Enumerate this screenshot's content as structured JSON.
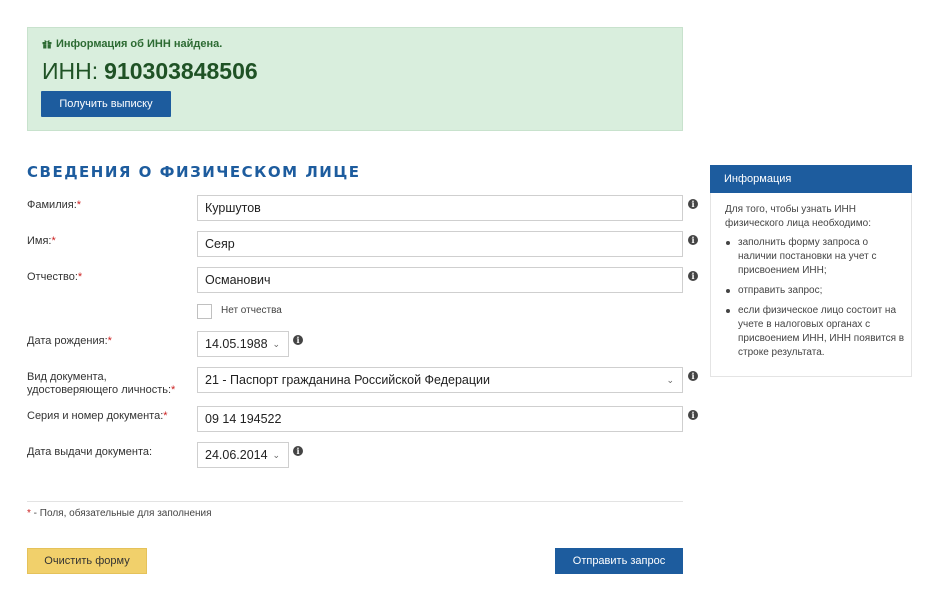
{
  "result": {
    "message": "Информация об ИНН найдена.",
    "inn_label": "ИНН:",
    "inn_value": "910303848506",
    "extract_button": "Получить выписку"
  },
  "section_title": "СВЕДЕНИЯ О ФИЗИЧЕСКОМ ЛИЦЕ",
  "form": {
    "surname": {
      "label": "Фамилия:",
      "value": "Куршутов"
    },
    "name": {
      "label": "Имя:",
      "value": "Сеяр"
    },
    "patronymic": {
      "label": "Отчество:",
      "value": "Османович"
    },
    "no_patronymic": {
      "label": "Нет отчества",
      "checked": false
    },
    "birth_date": {
      "label": "Дата рождения:",
      "value": "14.05.1988"
    },
    "doc_type": {
      "label_line1": "Вид документа,",
      "label_line2": "удостоверяющего личность:",
      "value": "21 - Паспорт гражданина Российской Федерации"
    },
    "doc_number": {
      "label": "Серия и номер документа:",
      "value": "09 14 194522"
    },
    "doc_date": {
      "label": "Дата выдачи документа:",
      "value": "24.06.2014"
    },
    "required_mark": "*",
    "footnote_text": " - Поля, обязательные для заполнения"
  },
  "buttons": {
    "clear": "Очистить форму",
    "submit": "Отправить запрос"
  },
  "info_panel": {
    "title": "Информация",
    "intro": "Для того, чтобы узнать ИНН физического лица необходимо:",
    "items": [
      "заполнить форму запроса о наличии постановки на учет с присвоением ИНН;",
      "отправить запрос;",
      "если физическое лицо состоит на учете в налоговых органах с присвоением ИНН, ИНН появится в строке результата."
    ]
  },
  "colors": {
    "accent": "#1d5c9e",
    "success_bg": "#d9eedd",
    "clear_button": "#f1d06b",
    "required": "#cc2222"
  }
}
